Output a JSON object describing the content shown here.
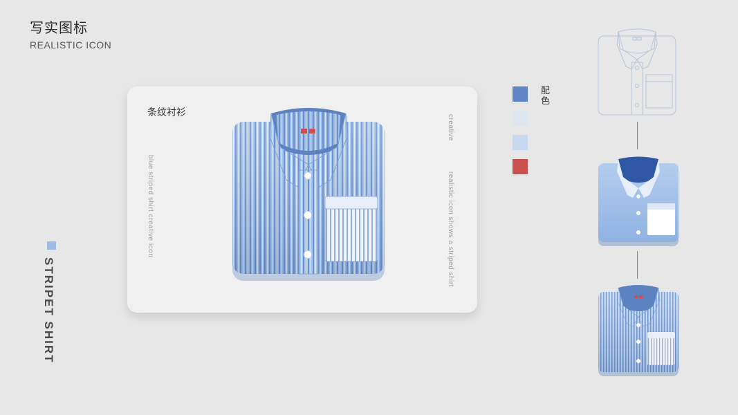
{
  "header": {
    "title_cn": "写实图标",
    "title_en": "REALISTIC   ICON"
  },
  "side": {
    "title": "STRIPET SHIRT"
  },
  "card": {
    "title": "条纹衬衫",
    "vertical_left": "blue striped shirt creative icon",
    "vertical_right_top": "creative",
    "vertical_right": "realistic icon shows a striped shirt"
  },
  "palette": {
    "label": "配色",
    "colors": [
      "#5f86c4",
      "#dde6ef",
      "#c6d9f1",
      "#cb4f4f"
    ]
  },
  "icons": {
    "main": "striped-shirt-icon",
    "steps": [
      "shirt-outline-icon",
      "flat-shirt-icon",
      "striped-shirt-icon"
    ]
  }
}
